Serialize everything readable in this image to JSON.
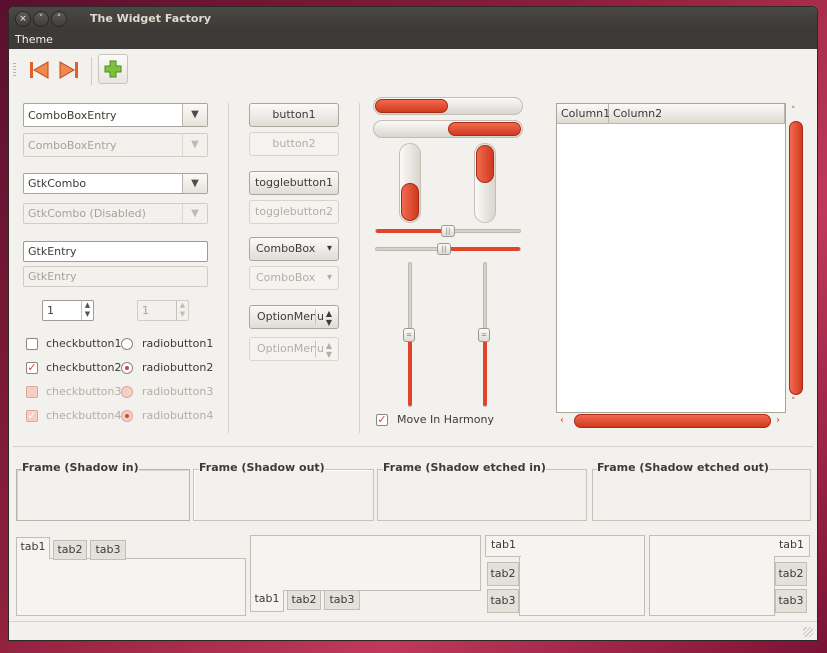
{
  "window": {
    "title": "The Widget Factory",
    "controls": [
      "close-icon",
      "minimize-icon",
      "maximize-icon"
    ]
  },
  "menubar": {
    "items": [
      "Theme"
    ]
  },
  "toolbar": {
    "icons": [
      "go-first-icon",
      "go-last-icon",
      "add-icon"
    ]
  },
  "combos": {
    "combo_entry": "ComboBoxEntry",
    "combo_entry_disabled": "ComboBoxEntry",
    "gtkcombo": "GtkCombo",
    "gtkcombo_disabled": "GtkCombo (Disabled)"
  },
  "entries": {
    "entry": "GtkEntry",
    "entry_disabled": "GtkEntry"
  },
  "spins": {
    "spin": "1",
    "spin_disabled": "1"
  },
  "checks": [
    {
      "label": "checkbutton1",
      "checked": false,
      "disabled": false
    },
    {
      "label": "checkbutton2",
      "checked": true,
      "disabled": false
    },
    {
      "label": "checkbutton3",
      "checked": false,
      "disabled": true
    },
    {
      "label": "checkbutton4",
      "checked": true,
      "disabled": true
    }
  ],
  "radios": [
    {
      "label": "radiobutton1",
      "selected": false,
      "disabled": false
    },
    {
      "label": "radiobutton2",
      "selected": true,
      "disabled": false
    },
    {
      "label": "radiobutton3",
      "selected": false,
      "disabled": true
    },
    {
      "label": "radiobutton4",
      "selected": true,
      "disabled": true
    }
  ],
  "buttons": {
    "button1": "button1",
    "button2": "button2",
    "toggle1": "togglebutton1",
    "toggle2": "togglebutton2",
    "combobox": "ComboBox",
    "combobox_disabled": "ComboBox",
    "optionmenu": "OptionMenu",
    "optionmenu_disabled": "OptionMenu"
  },
  "progress": {
    "hbar1_fraction": 0.5,
    "hbar2_fraction": 0.5,
    "vbar1_fraction": 0.5,
    "vbar2_fraction": 0.5
  },
  "scales": {
    "hscale1": 0.5,
    "hscale2": 0.5,
    "vscale1": 0.5,
    "vscale2": 0.5
  },
  "harmony": {
    "label": "Move In Harmony",
    "checked": true
  },
  "treeview": {
    "columns": [
      "Column1",
      "Column2"
    ]
  },
  "frames": [
    "Frame (Shadow in)",
    "Frame (Shadow out)",
    "Frame (Shadow etched in)",
    "Frame (Shadow etched out)"
  ],
  "notebooks": {
    "top": [
      "tab1",
      "tab2",
      "tab3"
    ],
    "bottom": [
      "tab1",
      "tab2",
      "tab3"
    ],
    "left": [
      "tab1",
      "tab2",
      "tab3"
    ],
    "right": [
      "tab1",
      "tab2",
      "tab3"
    ]
  },
  "colors": {
    "accent": "#dd4814",
    "background": "#f2f1ed",
    "titlebar": "#3c3b37"
  }
}
